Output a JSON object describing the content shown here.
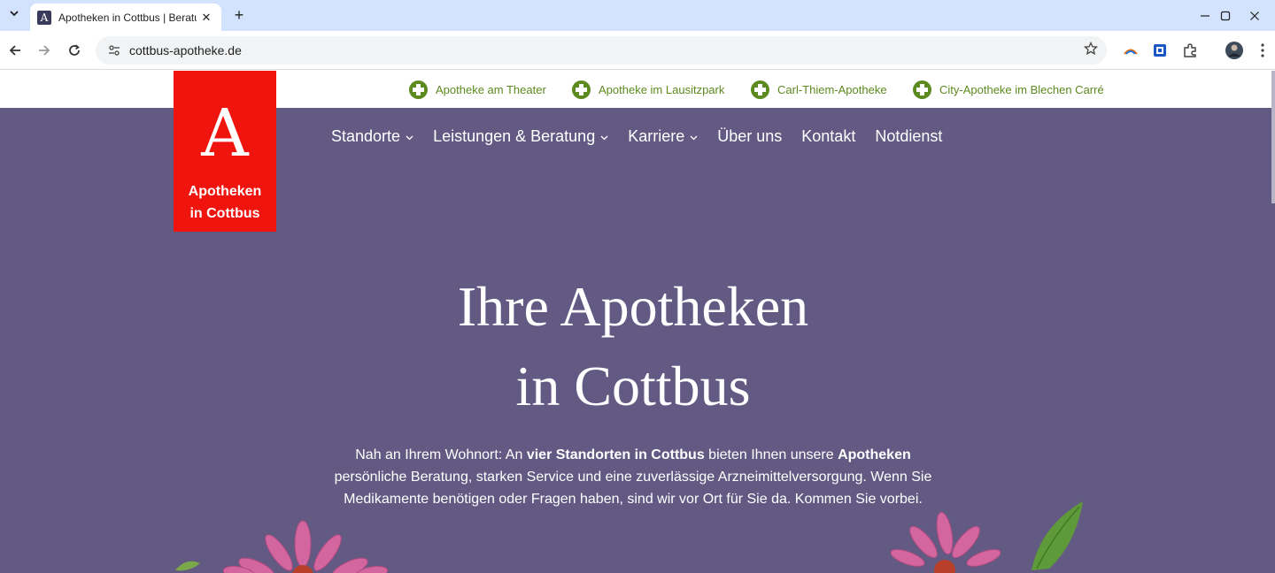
{
  "browser": {
    "tab_title": "Apotheken in Cottbus | Beratung",
    "tab_favicon": "A",
    "url": "cottbus-apotheke.de",
    "new_tab_symbol": "+",
    "close_symbol": "✕"
  },
  "topbar": {
    "locations": [
      {
        "label": "Apotheke am Theater"
      },
      {
        "label": "Apotheke im Lausitzpark"
      },
      {
        "label": "Carl-Thiem-Apotheke"
      },
      {
        "label": "City-Apotheke im Blechen Carré"
      }
    ]
  },
  "logo": {
    "letter": "A",
    "line1": "Apotheken",
    "line2": "in Cottbus"
  },
  "nav": {
    "items": [
      {
        "label": "Standorte",
        "dropdown": true
      },
      {
        "label": "Leistungen & Beratung",
        "dropdown": true
      },
      {
        "label": "Karriere",
        "dropdown": true
      },
      {
        "label": "Über uns",
        "dropdown": false
      },
      {
        "label": "Kontakt",
        "dropdown": false
      },
      {
        "label": "Notdienst",
        "dropdown": false
      }
    ]
  },
  "hero": {
    "title_line1": "Ihre Apotheken",
    "title_line2": "in Cottbus",
    "text_part1": "Nah an Ihrem Wohnort: An ",
    "text_bold1": "vier Standorten in Cottbus",
    "text_part2": " bieten Ihnen unsere ",
    "text_bold2": "Apotheken",
    "text_part3": " persönliche Beratung, starken Service und eine zuverlässige Arzneimittelversorgung. Wenn Sie Medikamente benötigen oder Fragen haben, sind wir vor Ort für Sie da. Kommen Sie vorbei."
  },
  "colors": {
    "hero_bg": "#635a84",
    "logo_red": "#f0140f",
    "location_green": "#5c8a1e",
    "browser_tabbar": "#d3e3fd"
  }
}
